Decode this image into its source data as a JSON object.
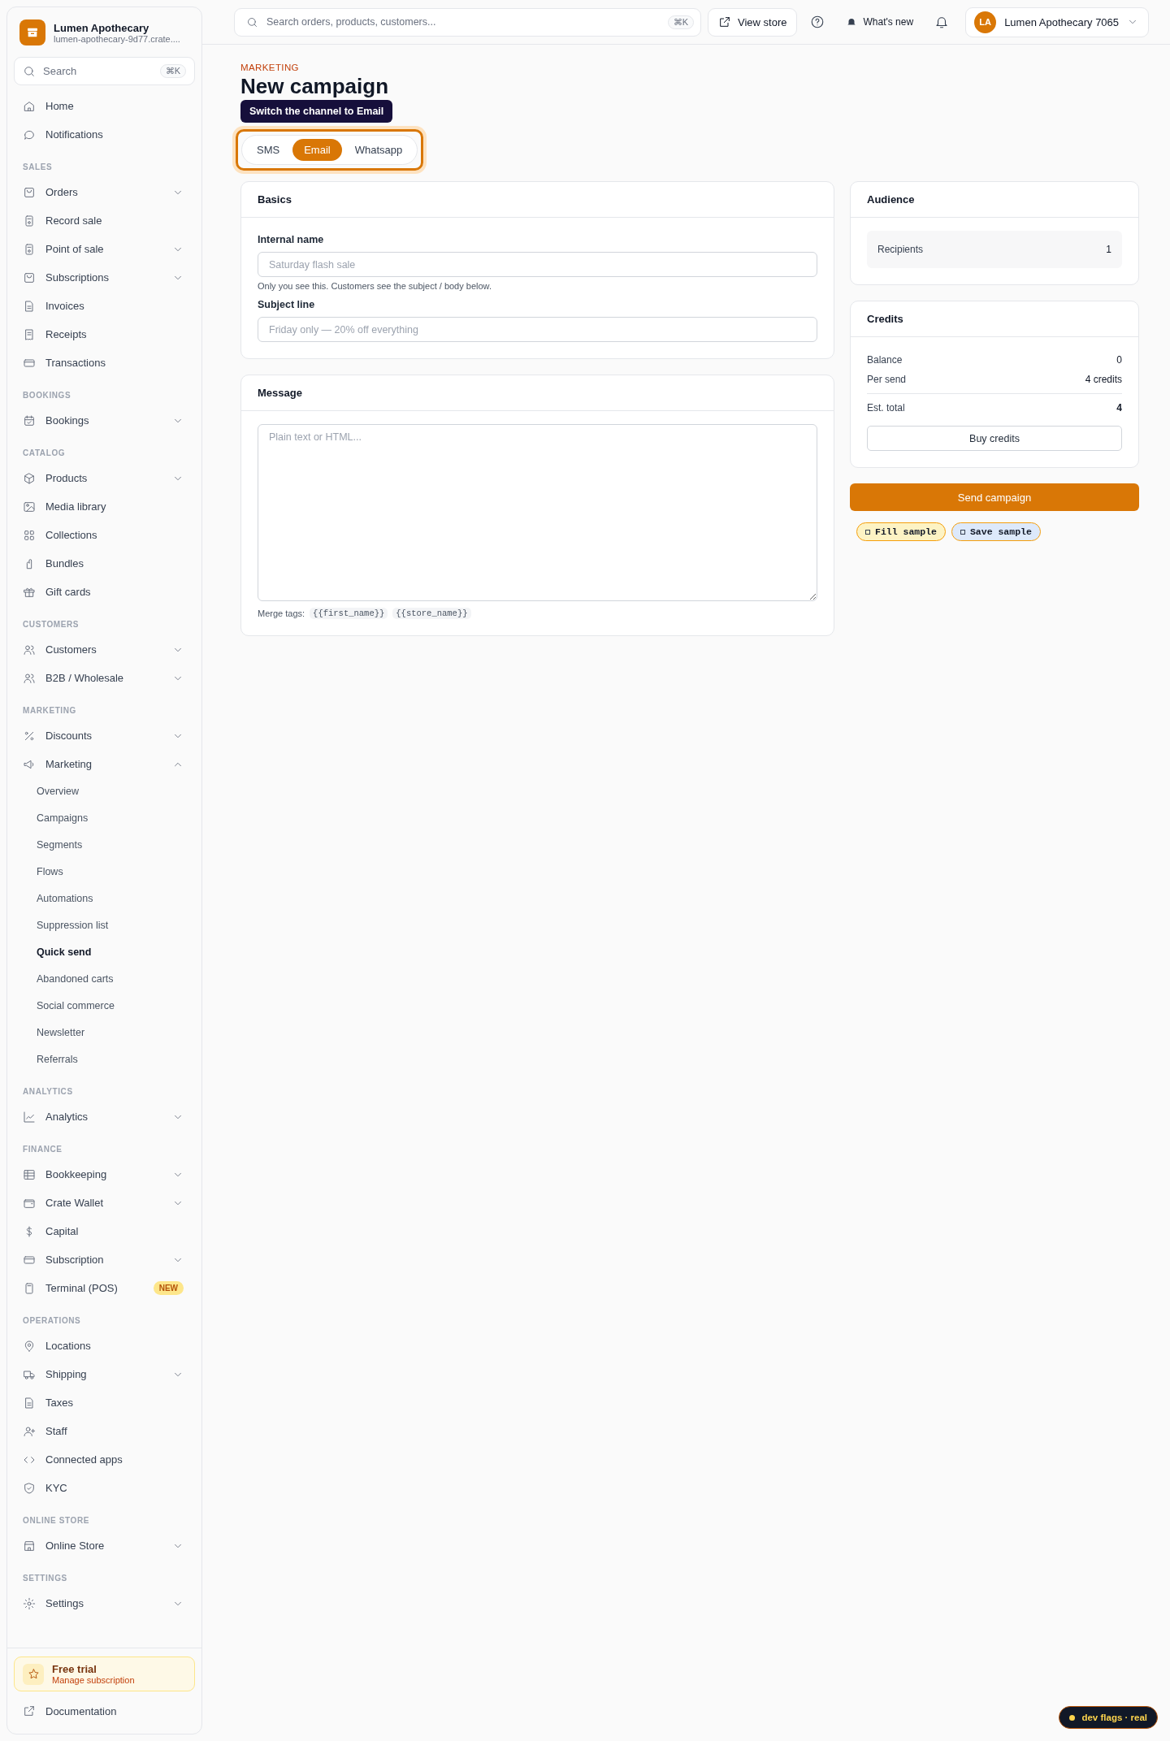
{
  "sidebar": {
    "store_name": "Lumen Apothecary",
    "store_url": "lumen-apothecary-9d77.crate....",
    "search": {
      "placeholder": "Search",
      "shortcut": "⌘K"
    },
    "top_items": [
      {
        "label": "Home"
      },
      {
        "label": "Notifications"
      }
    ],
    "sections": [
      {
        "title": "SALES",
        "items": [
          {
            "label": "Orders",
            "expanded": false
          },
          {
            "label": "Record sale"
          },
          {
            "label": "Point of sale",
            "expanded": false
          },
          {
            "label": "Subscriptions",
            "expanded": false
          },
          {
            "label": "Invoices"
          },
          {
            "label": "Receipts"
          },
          {
            "label": "Transactions"
          }
        ]
      },
      {
        "title": "BOOKINGS",
        "items": [
          {
            "label": "Bookings",
            "expanded": false
          }
        ]
      },
      {
        "title": "CATALOG",
        "items": [
          {
            "label": "Products",
            "expanded": false
          },
          {
            "label": "Media library"
          },
          {
            "label": "Collections"
          },
          {
            "label": "Bundles"
          },
          {
            "label": "Gift cards"
          }
        ]
      },
      {
        "title": "CUSTOMERS",
        "items": [
          {
            "label": "Customers",
            "expanded": false
          },
          {
            "label": "B2B / Wholesale",
            "expanded": false
          }
        ]
      },
      {
        "title": "MARKETING",
        "items": [
          {
            "label": "Discounts",
            "expanded": false
          },
          {
            "label": "Marketing",
            "expanded": true,
            "children": [
              {
                "label": "Overview",
                "selected": false
              },
              {
                "label": "Campaigns",
                "selected": false
              },
              {
                "label": "Segments",
                "selected": false
              },
              {
                "label": "Flows",
                "selected": false
              },
              {
                "label": "Automations",
                "selected": false
              },
              {
                "label": "Suppression list",
                "selected": false
              },
              {
                "label": "Quick send",
                "selected": true
              },
              {
                "label": "Abandoned carts",
                "selected": false
              },
              {
                "label": "Social commerce",
                "selected": false
              },
              {
                "label": "Newsletter",
                "selected": false
              },
              {
                "label": "Referrals",
                "selected": false
              }
            ]
          }
        ]
      },
      {
        "title": "ANALYTICS",
        "items": [
          {
            "label": "Analytics",
            "expanded": false
          }
        ]
      },
      {
        "title": "FINANCE",
        "items": [
          {
            "label": "Bookkeeping",
            "expanded": false
          },
          {
            "label": "Crate Wallet",
            "expanded": false
          },
          {
            "label": "Capital"
          },
          {
            "label": "Subscription",
            "expanded": false
          },
          {
            "label": "Terminal (POS)",
            "badge": "NEW"
          }
        ]
      },
      {
        "title": "OPERATIONS",
        "items": [
          {
            "label": "Locations"
          },
          {
            "label": "Shipping",
            "expanded": false
          },
          {
            "label": "Taxes"
          },
          {
            "label": "Staff"
          },
          {
            "label": "Connected apps"
          },
          {
            "label": "KYC"
          }
        ]
      },
      {
        "title": "ONLINE STORE",
        "items": [
          {
            "label": "Online Store",
            "expanded": false
          }
        ]
      },
      {
        "title": "SETTINGS",
        "items": [
          {
            "label": "Settings",
            "expanded": false
          }
        ]
      }
    ],
    "trial": {
      "title": "Free trial",
      "subtitle": "Manage subscription"
    },
    "footer_link": "Documentation"
  },
  "topbar": {
    "search": {
      "placeholder": "Search orders, products, customers...",
      "shortcut": "⌘K"
    },
    "view_store": "View store",
    "whats_new": "What's new",
    "account": {
      "initials": "LA",
      "name": "Lumen Apothecary 7065"
    }
  },
  "page": {
    "eyebrow": "MARKETING",
    "title": "New campaign",
    "tooltip": "Switch the channel to Email",
    "channels": [
      {
        "label": "SMS",
        "selected": false
      },
      {
        "label": "Email",
        "selected": true
      },
      {
        "label": "Whatsapp",
        "selected": false
      }
    ],
    "basics": {
      "title": "Basics",
      "fields": [
        {
          "label": "Internal name",
          "placeholder": "Saturday flash sale",
          "hint": "Only you see this. Customers see the subject / body below."
        },
        {
          "label": "Subject line",
          "placeholder": "Friday only — 20% off everything"
        }
      ]
    },
    "message": {
      "title": "Message",
      "placeholder": "Plain text or HTML...",
      "merge_label": "Merge tags:",
      "merge_tags": [
        "{{first_name}}",
        "{{store_name}}"
      ]
    },
    "audience": {
      "title": "Audience",
      "rows": [
        {
          "label": "Recipients",
          "value": "1"
        }
      ]
    },
    "credits": {
      "title": "Credits",
      "rows": [
        {
          "label": "Balance",
          "value": "0"
        },
        {
          "label": "Per send",
          "value": "4 credits"
        }
      ],
      "total": {
        "label": "Est. total",
        "value": "4"
      },
      "button": "Buy credits"
    },
    "send_button": "Send campaign",
    "dev_buttons": [
      {
        "label": "Fill sample",
        "color": "#fdf3c4"
      },
      {
        "label": "Save sample",
        "color": "#dde9fb"
      }
    ]
  },
  "dev_flag": "dev flags · real"
}
